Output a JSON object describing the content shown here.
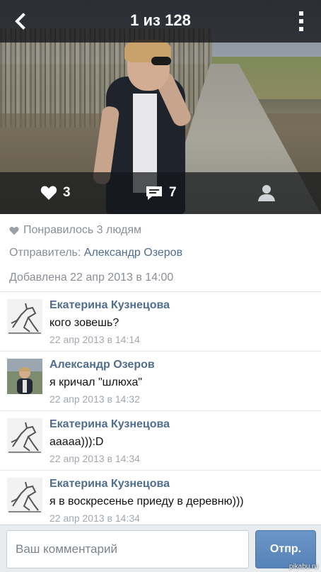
{
  "header": {
    "counter": "1 из 128",
    "back_icon": "chevron-left-icon",
    "menu_icon": "more-vertical-icon"
  },
  "stats": {
    "likes": "3",
    "comments": "7",
    "like_icon": "heart-icon",
    "comment_icon": "comment-icon",
    "tag_icon": "person-icon"
  },
  "info": {
    "liked_text": "Понравилось 3 людям",
    "sender_label": "Отправитель:",
    "sender_name": "Александр Озеров",
    "added_text": "Добавлена 22 апр 2013 в 14:00"
  },
  "comments": [
    {
      "author": "Екатерина Кузнецова",
      "text": "кого зовешь?",
      "time": "22 апр 2013 в 14:14"
    },
    {
      "author": "Александр Озеров",
      "text": "я кричал \"шлюха\"",
      "time": "22 апр 2013 в 14:32"
    },
    {
      "author": "Екатерина Кузнецова",
      "text": "ааааа))):D",
      "time": "22 апр 2013 в 14:34"
    },
    {
      "author": "Екатерина Кузнецова",
      "text": "я в воскресенье приеду в деревню)))",
      "time": "22 апр 2013 в 14:34"
    }
  ],
  "composer": {
    "placeholder": "Ваш комментарий",
    "send_label": "Отпр."
  },
  "watermark": "pikabu.ru",
  "colors": {
    "accent": "#4f6d8f",
    "send_button": "#5d89bd",
    "muted": "#8a8f96"
  }
}
